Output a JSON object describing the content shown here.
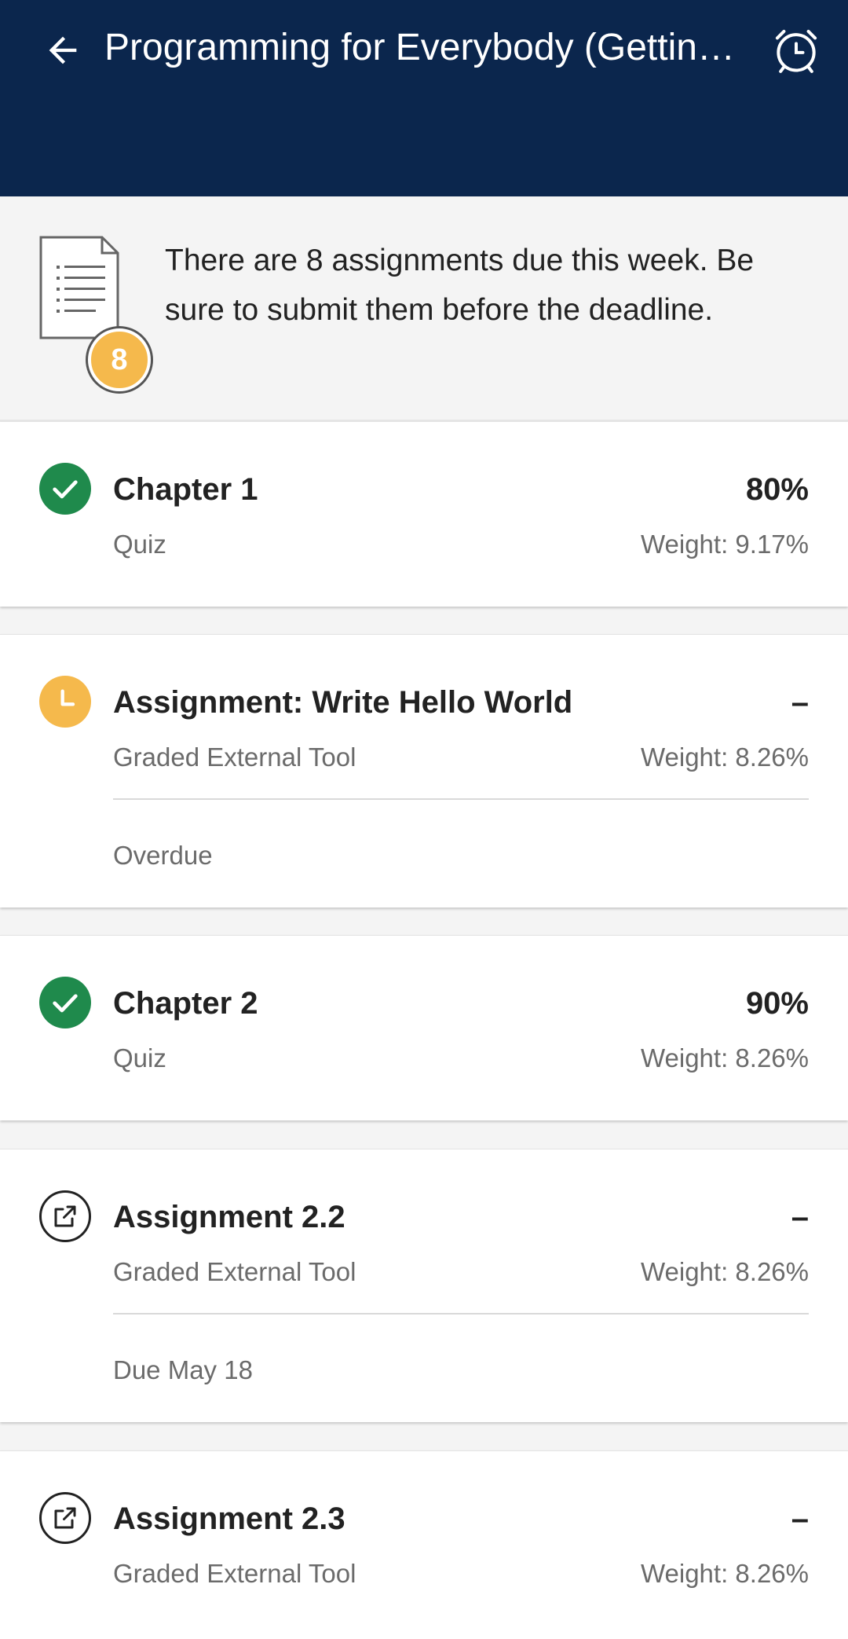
{
  "appbar": {
    "title": "Programming for Everybody (Gettin…",
    "back_icon": "arrow-left-icon",
    "alarm_icon": "alarm-clock-icon",
    "background": "#0b264d"
  },
  "banner": {
    "message": "There are 8 assignments due this week. Be sure to submit them before the deadline.",
    "badge_count": "8",
    "icon": "document-list-icon",
    "badge_color": "#f5b94c"
  },
  "items": [
    {
      "title": "Chapter 1",
      "type": "Quiz",
      "score": "80%",
      "weight_label": "Weight:",
      "weight_value": "9.17%",
      "status_icon": "check-circle-icon"
    },
    {
      "title": "Assignment: Write Hello World",
      "type": "Graded External Tool",
      "score": "–",
      "weight_label": "Weight:",
      "weight_value": "8.26%",
      "status_icon": "clock-icon",
      "due": "Overdue"
    },
    {
      "title": "Chapter 2",
      "type": "Quiz",
      "score": "90%",
      "weight_label": "Weight:",
      "weight_value": "8.26%",
      "status_icon": "check-circle-icon"
    },
    {
      "title": "Assignment 2.2",
      "type": "Graded External Tool",
      "score": "–",
      "weight_label": "Weight:",
      "weight_value": "8.26%",
      "status_icon": "external-link-icon",
      "due": "Due May 18"
    },
    {
      "title": "Assignment 2.3",
      "type": "Graded External Tool",
      "score": "–",
      "weight_label": "Weight:",
      "weight_value": "8.26%",
      "status_icon": "external-link-icon"
    }
  ],
  "colors": {
    "done": "#1f8a4c",
    "pending": "#f5b94c"
  }
}
